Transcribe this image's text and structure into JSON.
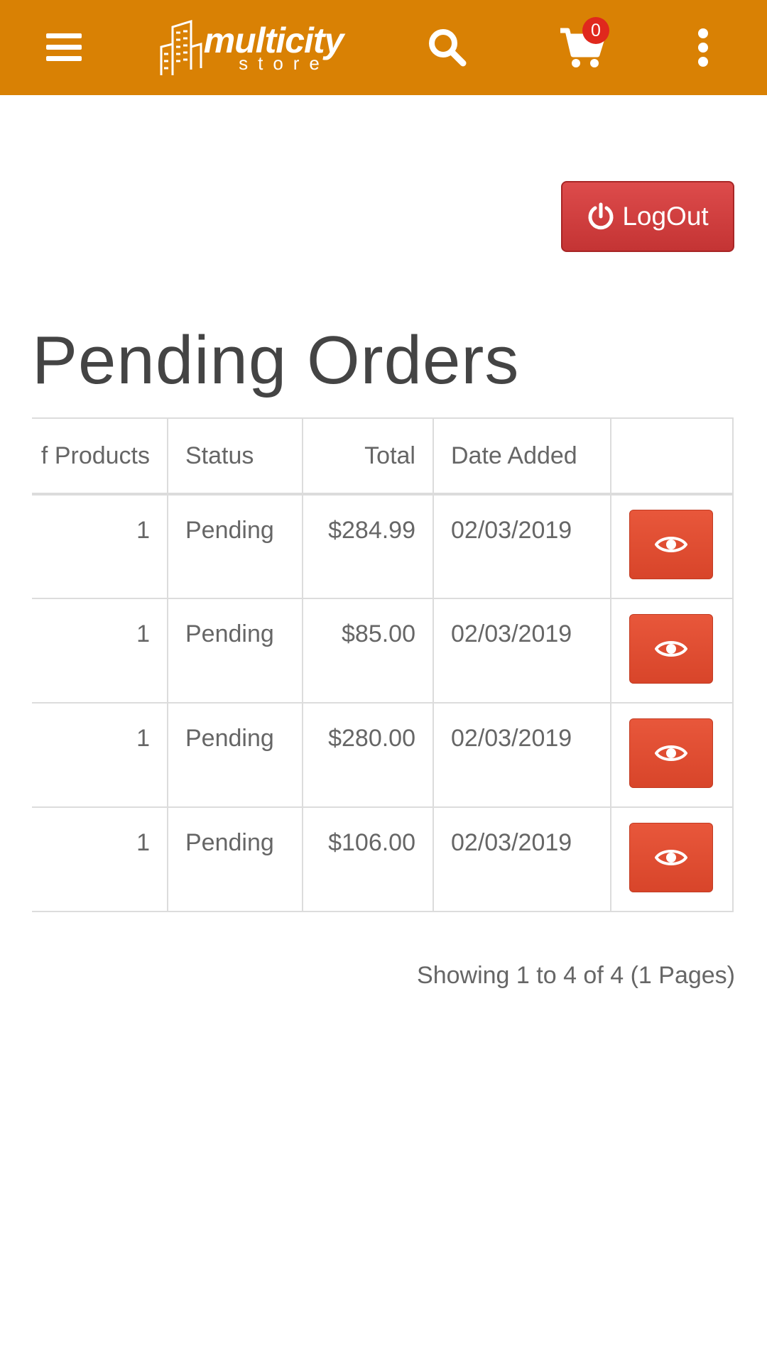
{
  "header": {
    "logo_word": "multicity",
    "logo_sub": "store",
    "cart_count": "0"
  },
  "logout_label": "LogOut",
  "page_title": "Pending Orders",
  "table": {
    "columns": [
      "f Products",
      "Status",
      "Total",
      "Date Added",
      ""
    ],
    "rows": [
      {
        "products": "1",
        "status": "Pending",
        "total": "$284.99",
        "date": "02/03/2019"
      },
      {
        "products": "1",
        "status": "Pending",
        "total": "$85.00",
        "date": "02/03/2019"
      },
      {
        "products": "1",
        "status": "Pending",
        "total": "$280.00",
        "date": "02/03/2019"
      },
      {
        "products": "1",
        "status": "Pending",
        "total": "$106.00",
        "date": "02/03/2019"
      }
    ]
  },
  "pagination_text": "Showing 1 to 4 of 4 (1 Pages)",
  "colors": {
    "header_bg": "#d98104",
    "logout_bg": "#c43434",
    "view_button": "#d8452a",
    "badge": "#e0281d"
  },
  "icons": [
    "menu-icon",
    "search-icon",
    "cart-icon",
    "more-vertical-icon",
    "power-icon",
    "eye-icon"
  ]
}
